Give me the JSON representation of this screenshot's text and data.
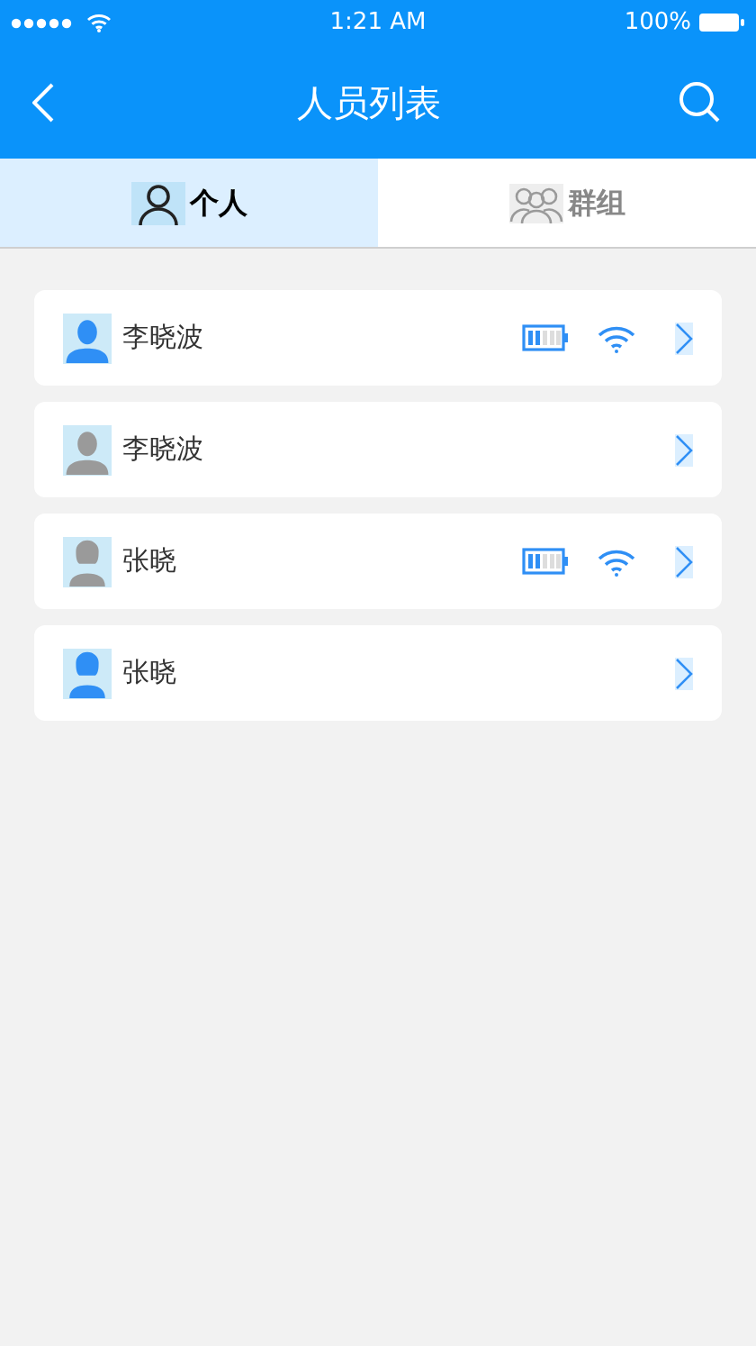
{
  "status_bar": {
    "time": "1:21 AM",
    "battery": "100%"
  },
  "header": {
    "title": "人员列表"
  },
  "tabs": [
    {
      "label": "个人",
      "selected": true,
      "kind": "person"
    },
    {
      "label": "群组",
      "selected": false,
      "kind": "group"
    }
  ],
  "people": [
    {
      "name": "李晓波",
      "kind": "male",
      "online": true,
      "device_status": true
    },
    {
      "name": "李晓波",
      "kind": "male",
      "online": false,
      "device_status": false
    },
    {
      "name": "张晓",
      "kind": "female",
      "online": false,
      "device_status": true
    },
    {
      "name": "张晓",
      "kind": "female",
      "online": true,
      "device_status": false
    }
  ]
}
